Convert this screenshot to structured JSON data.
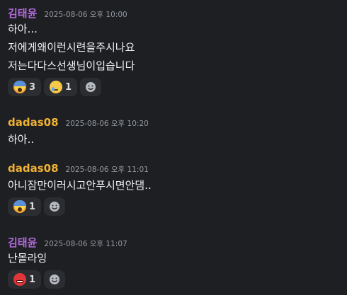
{
  "messages": [
    {
      "author": "김태윤",
      "author_color": "#b26bdc",
      "timestamp": "2025-08-06 오후 10:00",
      "lines": [
        "하아...",
        "저에게왜이런시련을주시나요",
        "저는다다스선생님이입습니다"
      ],
      "reactions": [
        {
          "emoji": "screaming-face",
          "count": "3"
        },
        {
          "emoji": "crying-face",
          "count": "1"
        }
      ]
    },
    {
      "author": "dadas08",
      "author_color": "#f0b232",
      "timestamp": "2025-08-06 오후 10:20",
      "lines": [
        "하아.."
      ]
    },
    {
      "author": "dadas08",
      "author_color": "#f0b232",
      "timestamp": "2025-08-06 오후 11:01",
      "lines": [
        "아니잠만이러시고안푸시면안댐.."
      ],
      "reactions": [
        {
          "emoji": "screaming-face",
          "count": "1"
        }
      ]
    },
    {
      "author": "김태윤",
      "author_color": "#b26bdc",
      "timestamp": "2025-08-06 오후 11:07",
      "lines": [
        "난몰라잉"
      ],
      "reactions": [
        {
          "emoji": "angry-face",
          "count": "1"
        }
      ]
    }
  ]
}
